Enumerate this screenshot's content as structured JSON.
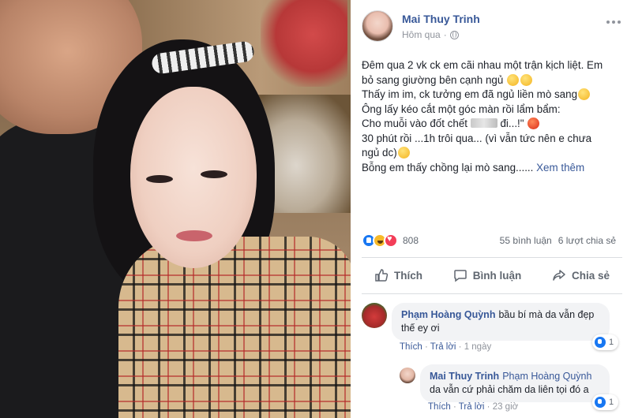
{
  "post": {
    "author": "Mai Thuy Trinh",
    "time": "Hôm qua",
    "text_lines": [
      "Đêm qua 2 vk ck em cãi nhau một trận kịch liệt. Em",
      "bỏ sang giường bên cạnh ngủ",
      "Thấy im im, ck tưởng em đã ngủ liền mò sang",
      "Ông lấy kéo cắt một góc màn rồi lẩm bẩm:",
      "Cho muỗi vào đốt chết",
      " đi...!\"",
      "30 phút rồi ...1h trôi qua... (vì vẫn tức nên e chưa",
      "ngủ dc)",
      "Bỗng em thấy chồng lại mò sang......"
    ],
    "see_more": "Xem thêm"
  },
  "stats": {
    "reaction_count": "808",
    "comments": "55 bình luận",
    "shares": "6 lượt chia sẻ"
  },
  "actions": {
    "like": "Thích",
    "comment": "Bình luận",
    "share": "Chia sẻ"
  },
  "comments": [
    {
      "name": "Phạm Hoàng Quỳnh",
      "text_line1": "bầu bí mà da vẫn đẹp",
      "text_line2": "thế ey ơi",
      "like": "Thích",
      "reply": "Trả lời",
      "time": "1 ngày",
      "likes": "1"
    },
    {
      "name": "Mai Thuy Trinh",
      "tag": "Phạm Hoàng Quỳnh",
      "text_line2": "da vẫn cứ phải chăm da liên tọi đó a",
      "like": "Thích",
      "reply": "Trả lời",
      "time": "23 giờ",
      "likes": "1"
    }
  ],
  "icons": [
    "globe-icon",
    "more-icon",
    "like-icon",
    "comment-icon",
    "share-icon",
    "haha-react-icon",
    "love-react-icon"
  ]
}
